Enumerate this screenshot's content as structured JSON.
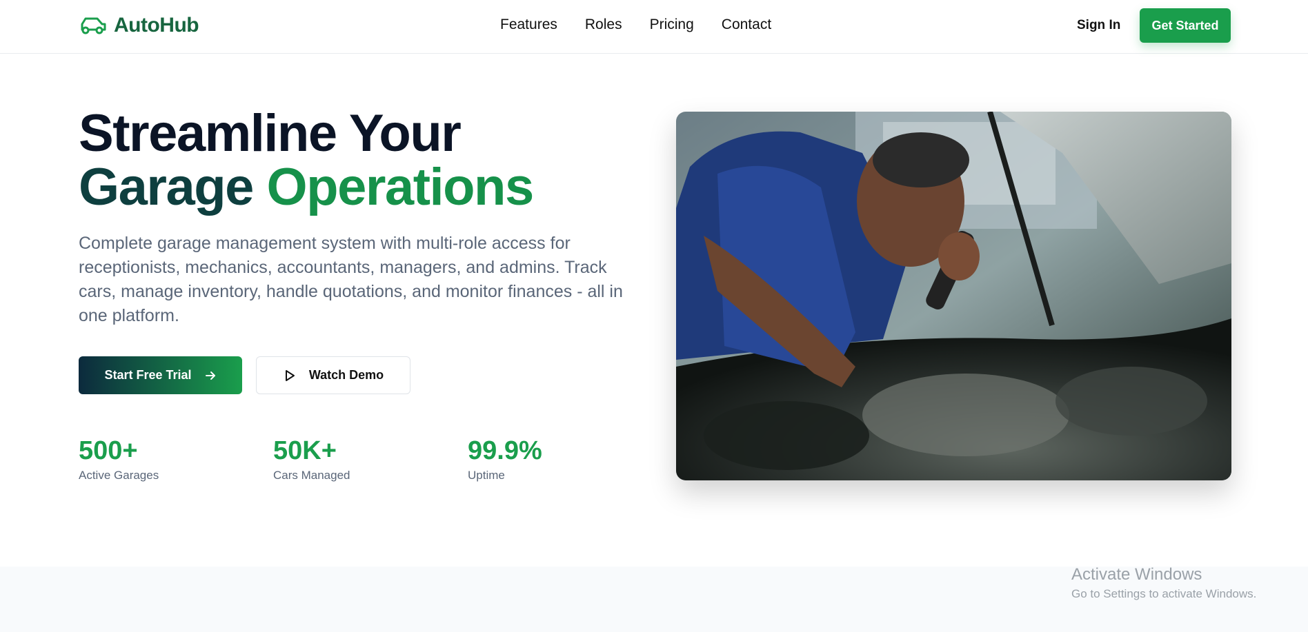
{
  "brand": {
    "name": "AutoHub",
    "color": "#1a9e4c"
  },
  "nav": {
    "items": [
      "Features",
      "Roles",
      "Pricing",
      "Contact"
    ]
  },
  "auth": {
    "sign_in": "Sign In",
    "get_started": "Get Started"
  },
  "hero": {
    "title_line1": "Streamline Your",
    "title_line2_a": "Garage",
    "title_line2_b": "Operations",
    "description": "Complete garage management system with multi-role access for receptionists, mechanics, accountants, managers, and admins. Track cars, manage inventory, handle quotations, and monitor finances - all in one platform.",
    "primary_cta": "Start Free Trial",
    "secondary_cta": "Watch Demo",
    "image_icon": "mechanic-photo"
  },
  "stats": [
    {
      "value": "500+",
      "label": "Active Garages"
    },
    {
      "value": "50K+",
      "label": "Cars Managed"
    },
    {
      "value": "99.9%",
      "label": "Uptime"
    }
  ],
  "watermark": {
    "line1": "Activate Windows",
    "line2": "Go to Settings to activate Windows."
  }
}
